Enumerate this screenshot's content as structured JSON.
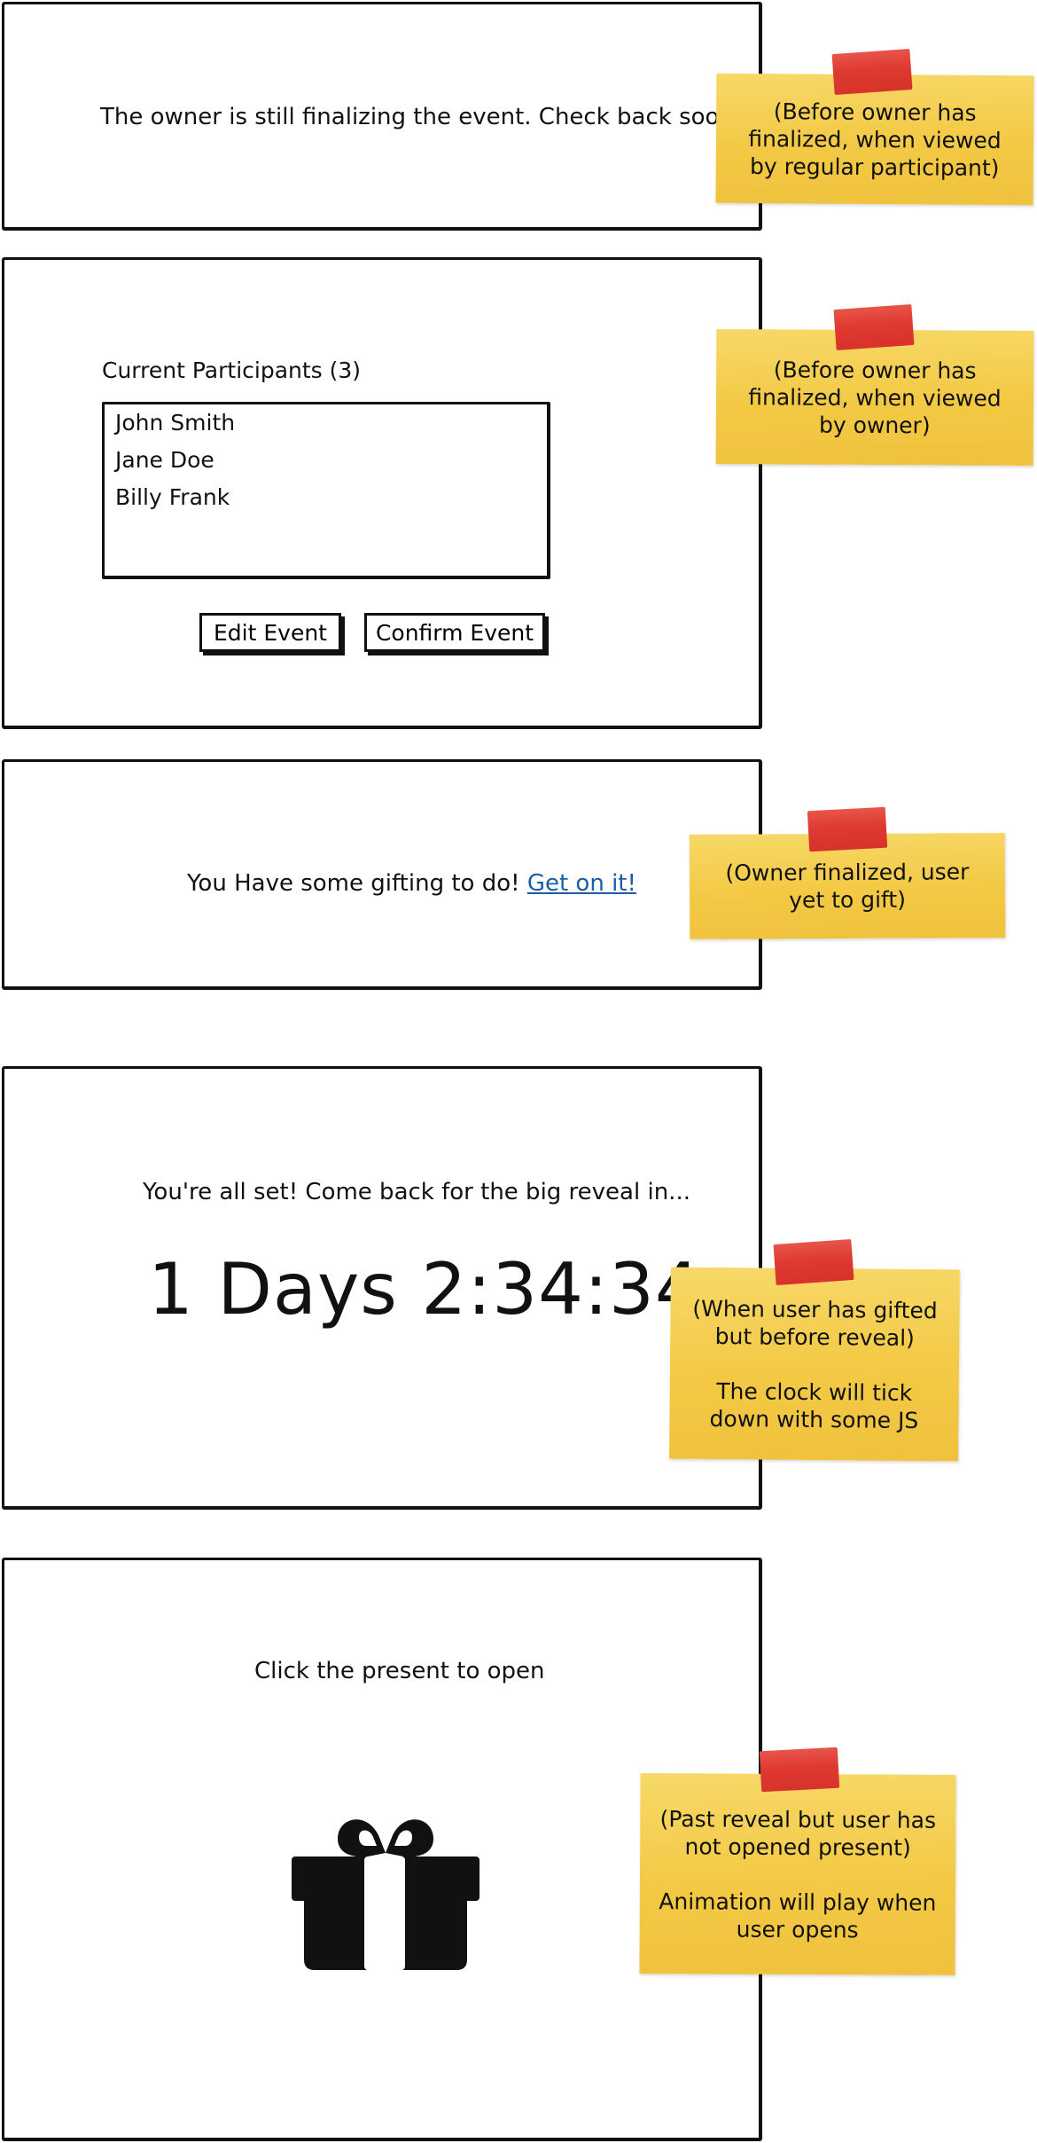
{
  "panel_pending_participant": {
    "message": "The owner is still finalizing the event. Check back soon!",
    "note": "(Before owner has finalized, when viewed by regular participant)"
  },
  "panel_pending_owner": {
    "participants_label": "Current Participants (3)",
    "participants": [
      "John Smith",
      "Jane Doe",
      "Billy Frank"
    ],
    "edit_button": "Edit Event",
    "confirm_button": "Confirm Event",
    "note": "(Before owner has finalized, when viewed by owner)"
  },
  "panel_to_gift": {
    "message": "You Have some gifting to do!",
    "link": "Get on it!",
    "note": "(Owner finalized, user yet to gift)"
  },
  "panel_countdown": {
    "message": "You're all set! Come back for the big reveal in...",
    "countdown": "1 Days 2:34:34",
    "note_line1": "(When user has gifted but before reveal)",
    "note_line2": "The clock will tick down with some JS"
  },
  "panel_reveal": {
    "message": "Click the present to open",
    "icon": "gift-icon",
    "note_line1": "(Past reveal but user has not opened present)",
    "note_line2": "Animation will play when user opens"
  },
  "colors": {
    "sticky_note": "#f3c944",
    "tape": "#de3a30",
    "link": "#1a5ea8"
  }
}
